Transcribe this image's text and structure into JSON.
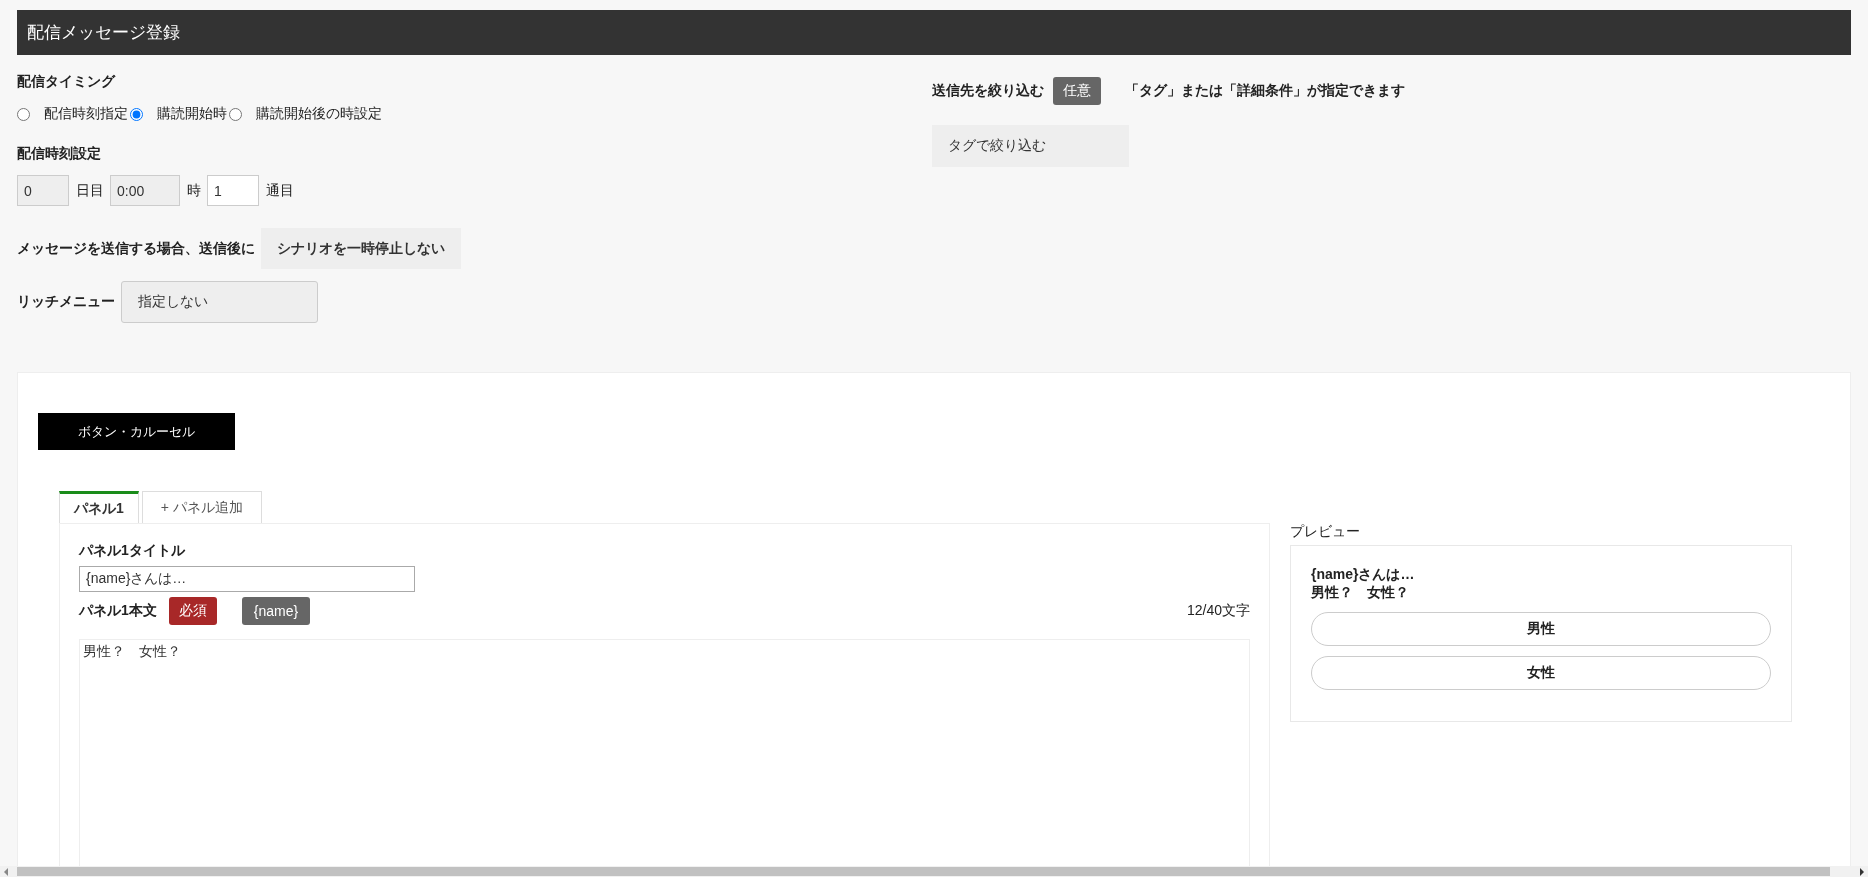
{
  "header": {
    "title": "配信メッセージ登録"
  },
  "timing": {
    "label": "配信タイミング",
    "options": [
      {
        "label": "配信時刻指定",
        "selected": false
      },
      {
        "label": "購読開始時",
        "selected": true
      },
      {
        "label": "購読開始後の時設定",
        "selected": false
      }
    ]
  },
  "time_setting": {
    "label": "配信時刻設定",
    "fields": [
      {
        "value": "0",
        "unit": "日目",
        "disabled": true
      },
      {
        "value": "0:00",
        "unit": "時",
        "disabled": true
      },
      {
        "value": "1",
        "unit": "通目",
        "disabled": false
      }
    ]
  },
  "pause": {
    "label": "メッセージを送信する場合、送信後に",
    "value": "シナリオを一時停止しない"
  },
  "rich_menu": {
    "label": "リッチメニュー",
    "value": "指定しない"
  },
  "filter": {
    "label": "送信先を絞り込む",
    "badge": "任意",
    "note": "「タグ」または「詳細条件」が指定できます",
    "tag_button": "タグで絞り込む"
  },
  "type_button": "ボタン・カルーセル",
  "tabs": [
    {
      "label": "パネル1",
      "selected": true
    },
    {
      "label": "+ パネル追加",
      "selected": false
    }
  ],
  "panel": {
    "title_label": "パネル1タイトル",
    "title_value": "{name}さんは…",
    "body_label": "パネル1本文",
    "required_badge": "必須",
    "insert_button": "{name}",
    "counter": "12/40文字",
    "body_value": "男性？　女性？"
  },
  "preview": {
    "label": "プレビュー",
    "title": "{name}さんは…",
    "text": "男性？　女性？",
    "buttons": [
      "男性",
      "女性"
    ]
  }
}
